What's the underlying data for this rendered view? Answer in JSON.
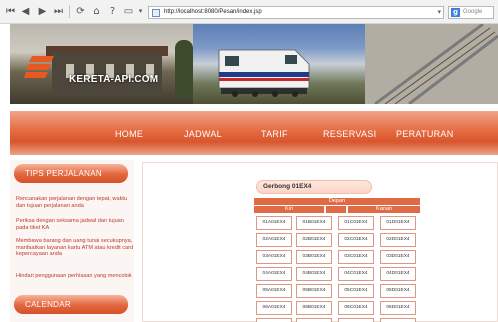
{
  "browser": {
    "url": "http://localhost:8080/Pesan/index.jsp",
    "search_placeholder": "Google",
    "search_logo": "g",
    "icons": [
      "first-icon",
      "back-icon",
      "forward-icon",
      "last-icon",
      "reload-icon",
      "home-icon",
      "help-icon",
      "page-icon",
      "dropdown-icon"
    ]
  },
  "banner": {
    "logo_text": "KERETA-API.COM",
    "logo_color": "#e8591f"
  },
  "nav": {
    "items": [
      "HOME",
      "JADWAL",
      "TARIF",
      "RESERVASI",
      "PERATURAN"
    ]
  },
  "sidebar": {
    "tips_title": "TIPS PERJALANAN",
    "tips": [
      "Rencanakan perjalanan dengan tepat, waktu dan tujuan perjalanan anda",
      "Periksa dengan seksama jadwal dan tujuan pada tiket KA",
      "Membawa barang dan uang tunai secukupnya, manfaatkan layanan kartu ATM atau kredit card kepercayaan anda",
      "Hindari penggunaan perhiasan yang mencolok"
    ],
    "calendar_title": "CALENDAR"
  },
  "content": {
    "gerbong_title": "Gerbong 01EX4",
    "depan_label": "Depan",
    "kiri_label": "Kiri",
    "kanan_label": "Kanan",
    "seats": [
      [
        "01A01EX4",
        "01B01EX4",
        "01C01EX4",
        "01D01EX4"
      ],
      [
        "02A01EX4",
        "02B01EX4",
        "02C01EX4",
        "02D01EX4"
      ],
      [
        "03A01EX4",
        "03B01EX4",
        "03C01EX4",
        "03D01EX4"
      ],
      [
        "04A01EX4",
        "04B01EX4",
        "04C01EX4",
        "04D01EX4"
      ],
      [
        "05A01EX4",
        "05B01EX4",
        "05C01EX4",
        "05D01EX4"
      ],
      [
        "06A01EX4",
        "06B01EX4",
        "06C01EX4",
        "06D01EX4"
      ],
      [
        "07A01EX4",
        "07B01EX4",
        "07C01EX4",
        "07D01EX4"
      ]
    ]
  },
  "colors": {
    "accent": "#e3663e",
    "header_orange": "#df6a43",
    "tip_text": "#c0392b"
  }
}
